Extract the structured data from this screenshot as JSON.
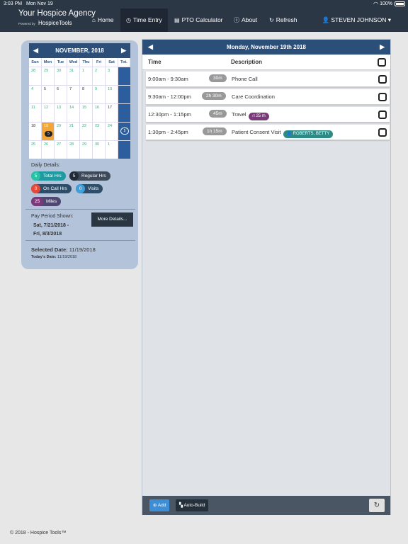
{
  "status_bar": {
    "time": "3:03 PM",
    "date": "Mon Nov 19",
    "battery": "100%"
  },
  "brand": {
    "name": "Your Hospice Agency",
    "powered_by": "Powered by",
    "tools": "HospiceTools"
  },
  "nav": {
    "home": "Home",
    "time_entry": "Time Entry",
    "pto": "PTO Calculator",
    "about": "About",
    "refresh": "Refresh",
    "user": "STEVEN JOHNSON"
  },
  "calendar": {
    "month": "NOVEMBER, 2018",
    "day_headers": [
      "Sun",
      "Mon",
      "Tue",
      "Wed",
      "Thu",
      "Fri",
      "Sat",
      "Tot."
    ],
    "weeks": [
      {
        "days": [
          "28",
          "29",
          "30",
          "31",
          "1",
          "2",
          "3"
        ],
        "muted": [
          true,
          true,
          true,
          true,
          true,
          true,
          true
        ]
      },
      {
        "days": [
          "4",
          "5",
          "6",
          "7",
          "8",
          "9",
          "10"
        ],
        "muted": [
          true,
          false,
          false,
          false,
          false,
          true,
          true
        ]
      },
      {
        "days": [
          "11",
          "12",
          "13",
          "14",
          "15",
          "16",
          "17"
        ],
        "muted": [
          true,
          true,
          true,
          true,
          true,
          true,
          false
        ]
      },
      {
        "days": [
          "18",
          "19",
          "20",
          "21",
          "22",
          "23",
          "24"
        ],
        "muted": [
          false,
          false,
          true,
          true,
          true,
          true,
          true
        ],
        "total": "5"
      },
      {
        "days": [
          "25",
          "26",
          "27",
          "28",
          "29",
          "30",
          "1"
        ],
        "muted": [
          true,
          true,
          true,
          true,
          true,
          true,
          true
        ]
      }
    ],
    "selected_day": "19",
    "selected_count": "5"
  },
  "daily": {
    "label": "Daily Details:",
    "total_hrs": {
      "n": "5",
      "label": "Total Hrs"
    },
    "regular_hrs": {
      "n": "5",
      "label": "Regular Hrs"
    },
    "on_call": {
      "n": "0",
      "label": "On Call Hrs"
    },
    "visits": {
      "n": "0",
      "label": "Visits"
    },
    "miles": {
      "n": "25",
      "label": "Miles"
    }
  },
  "pay_period": {
    "label": "Pay Period Shown:",
    "start": "Sat, 7/21/2018 -",
    "end": "Fri, 8/3/2018",
    "more_button": "More Details..."
  },
  "selected": {
    "label": "Selected Date:",
    "value": "11/19/2018",
    "today_label": "Today's Date:",
    "today_value": "11/19/2018"
  },
  "main": {
    "title": "Monday, November 19th 2018",
    "col_time": "Time",
    "col_desc": "Description",
    "entries": [
      {
        "time": "9:00am - 9:30am",
        "duration": "30m",
        "description": "Phone Call"
      },
      {
        "time": "9:30am - 12:00pm",
        "duration": "2h 30m",
        "description": "Care Coordination"
      },
      {
        "time": "12:30pm - 1:15pm",
        "duration": "45m",
        "description": "Travel",
        "tag": "25 m"
      },
      {
        "time": "1:30pm - 2:45pm",
        "duration": "1h 15m",
        "description": "Patient Consent Visit",
        "tag": "ROBERTS, BETTY"
      }
    ],
    "add_button": "Add",
    "autobuild_button": "Auto-Build"
  },
  "footer": "© 2018 - Hospice Tools™"
}
